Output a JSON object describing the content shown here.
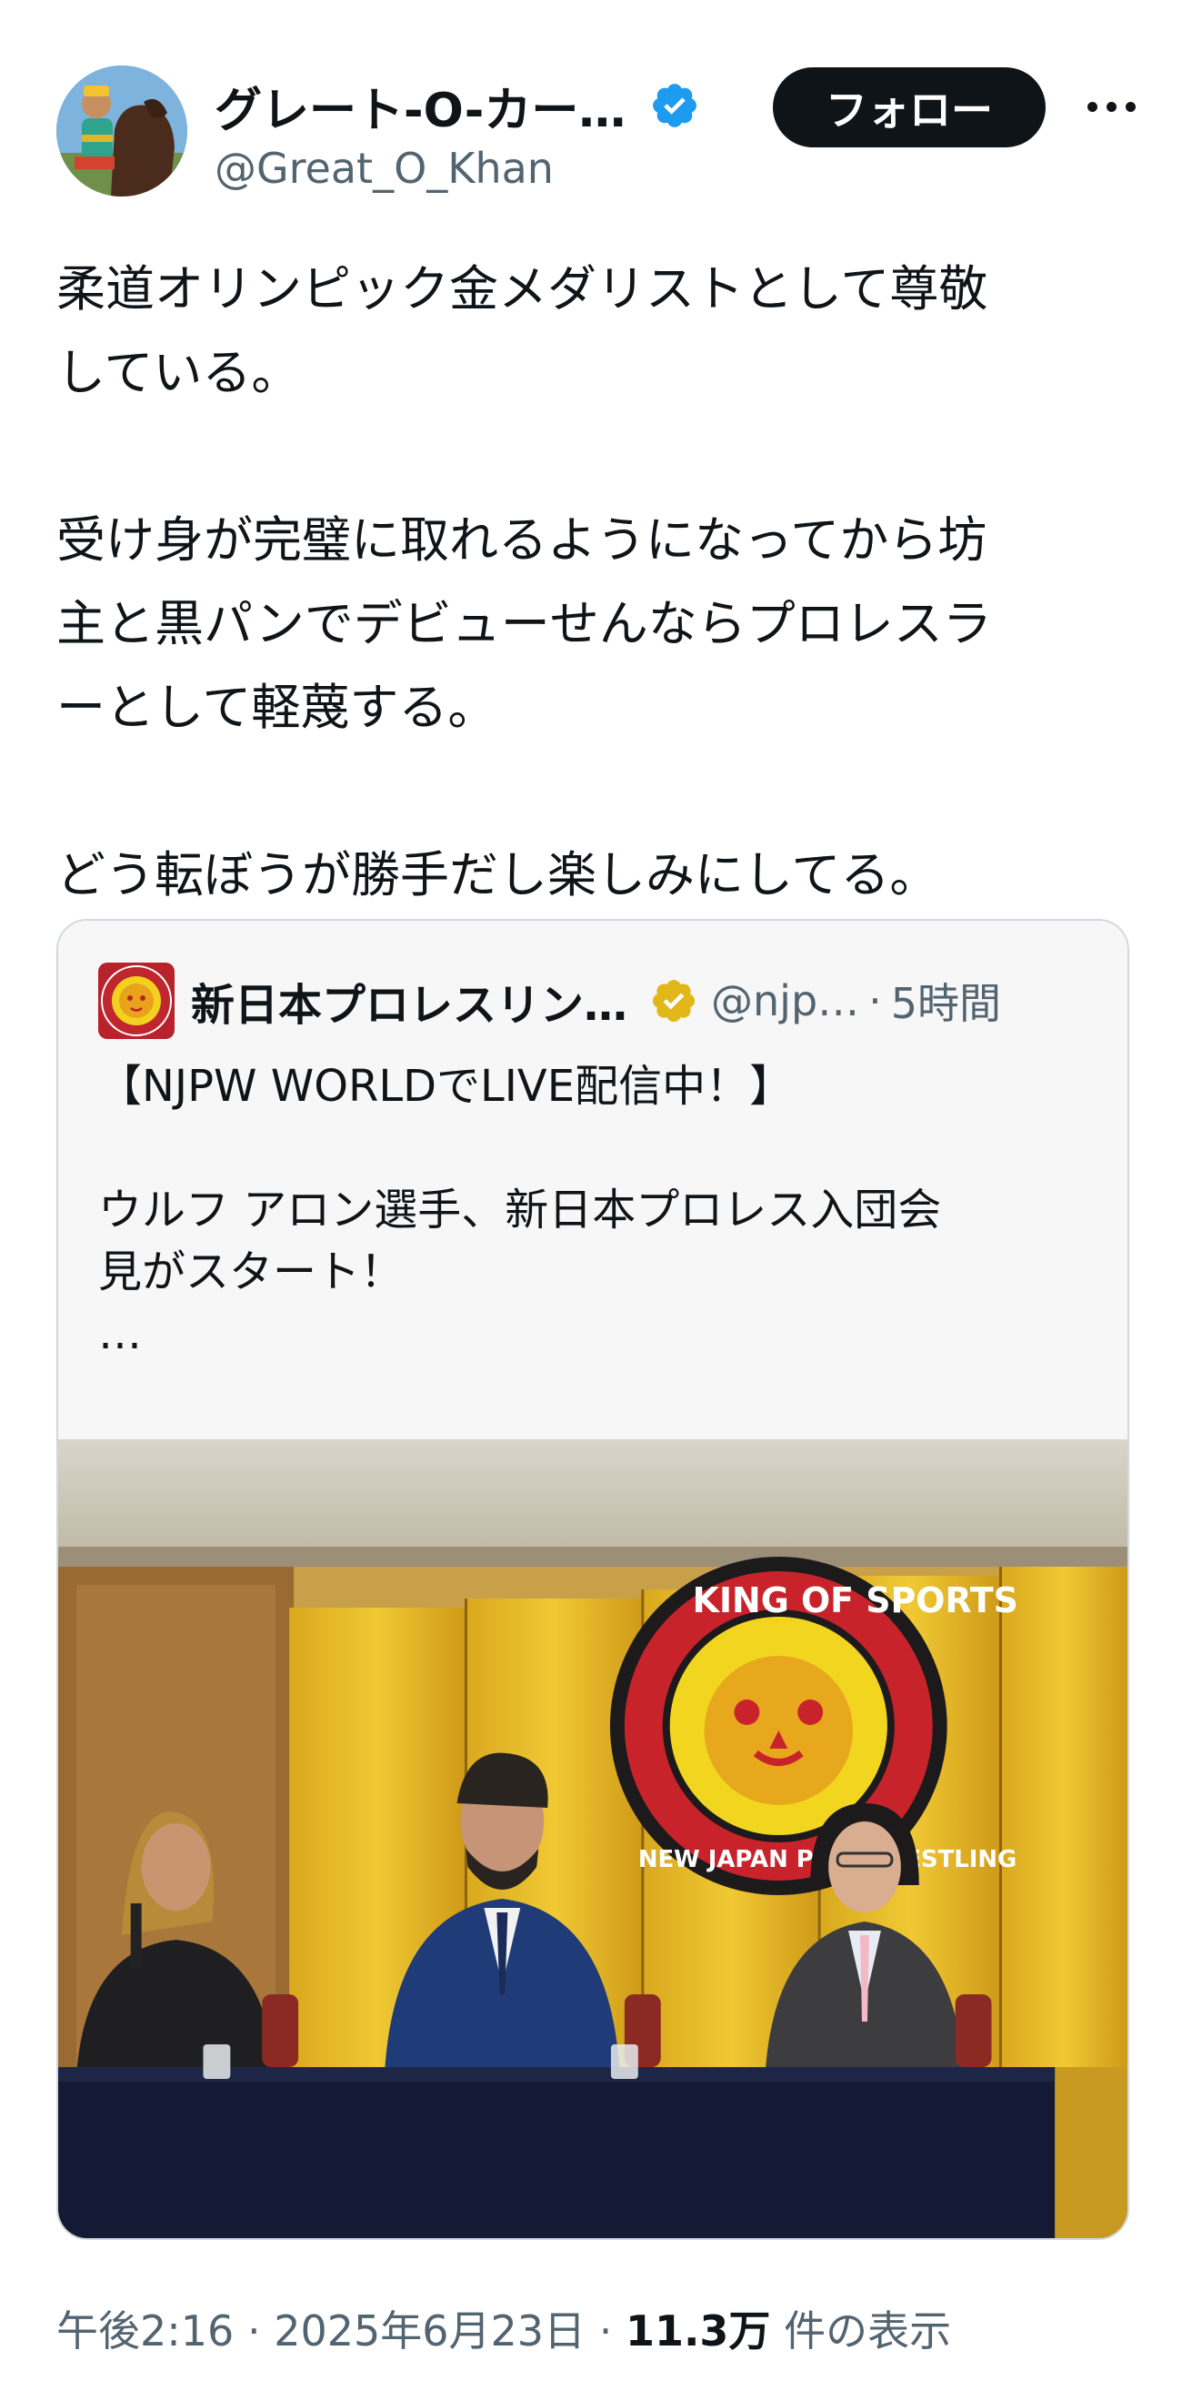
{
  "author": {
    "display_name": "グレート-O-カー…",
    "handle": "@Great_O_Khan",
    "follow_label": "フォロー"
  },
  "tweet": {
    "lines": [
      "柔道オリンピック金メダリストとして尊敬",
      "している。",
      "",
      "受け身が完璧に取れるようになってから坊",
      "主と黒パンでデビューせんならプロレスラ",
      "ーとして軽蔑する。",
      "",
      "どう転ぼうが勝手だし楽しみにしてる。"
    ]
  },
  "quoted": {
    "display_name": "新日本プロレスリン…",
    "handle": "@njp…",
    "separator": "·",
    "time": "5時間",
    "lines": [
      "【NJPW WORLDでLIVE配信中！】",
      "",
      "ウルフ アロン選手、新日本プロレス入団会",
      "見がスタート！",
      "…"
    ],
    "logo_text_top": "KING OF SPORTS",
    "logo_text_bottom": "NEW JAPAN PRO-WRESTLING"
  },
  "meta": {
    "time": "午後2:16",
    "sep1": "·",
    "date": "2025年6月23日",
    "sep2": "·",
    "views": "11.3万",
    "views_suffix": "件の表示"
  },
  "colors": {
    "verified_blue": "#1d9bf0",
    "verified_gold": "#e2b719",
    "follow_bg": "#0f1419",
    "muted": "#536471"
  },
  "icons": [
    "verified-badge-icon",
    "gold-verified-badge-icon",
    "more-icon"
  ]
}
